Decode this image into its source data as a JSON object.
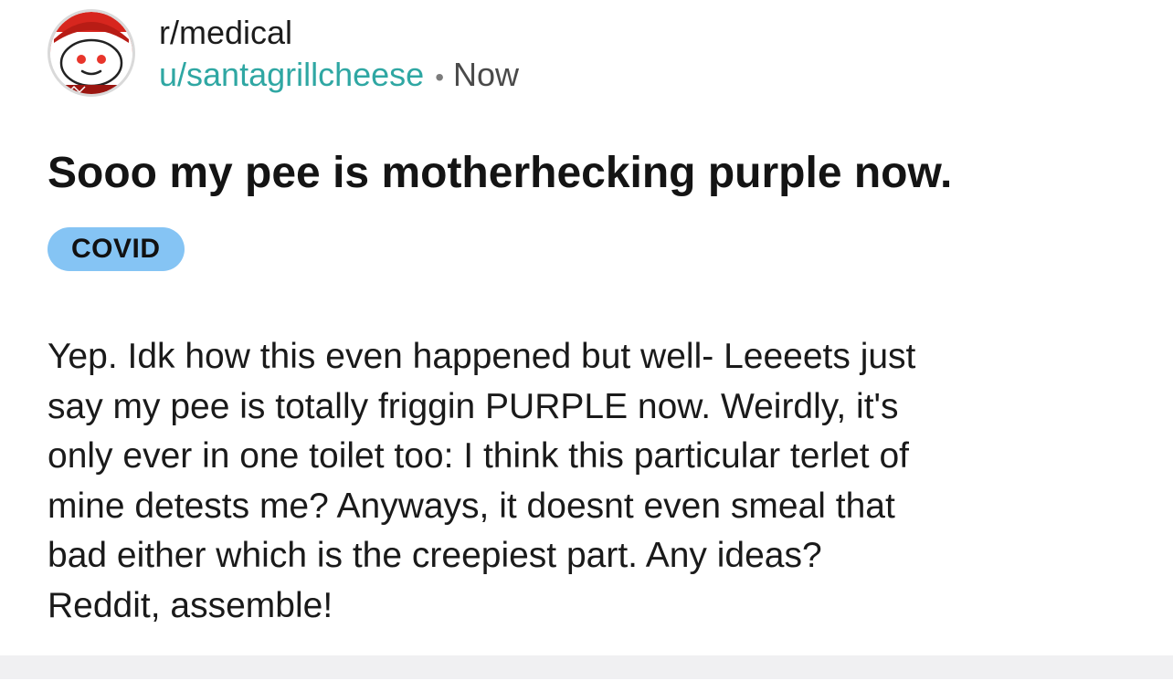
{
  "post": {
    "subreddit": "r/medical",
    "username": "u/santagrillcheese",
    "separator": "•",
    "time": "Now",
    "title": "Sooo my pee is motherhecking purple now.",
    "flair": "COVID",
    "body_lines": [
      "Yep. Idk how this even happened but well- Leeeets just",
      "say my pee is totally friggin PURPLE now. Weirdly, it's",
      "only ever in one toilet too: I think this particular terlet of",
      "mine detests me? Anyways, it doesnt even smeal that",
      "bad either which is the creepiest part. Any ideas?",
      "Reddit, assemble!"
    ]
  },
  "colors": {
    "username": "#2fa7a3",
    "flair_bg": "#85c4f4",
    "avatar_red": "#d7261e",
    "footer_bar": "#f0f0f2"
  },
  "icons": {
    "avatar": "reddit-snoo-avatar-icon"
  }
}
